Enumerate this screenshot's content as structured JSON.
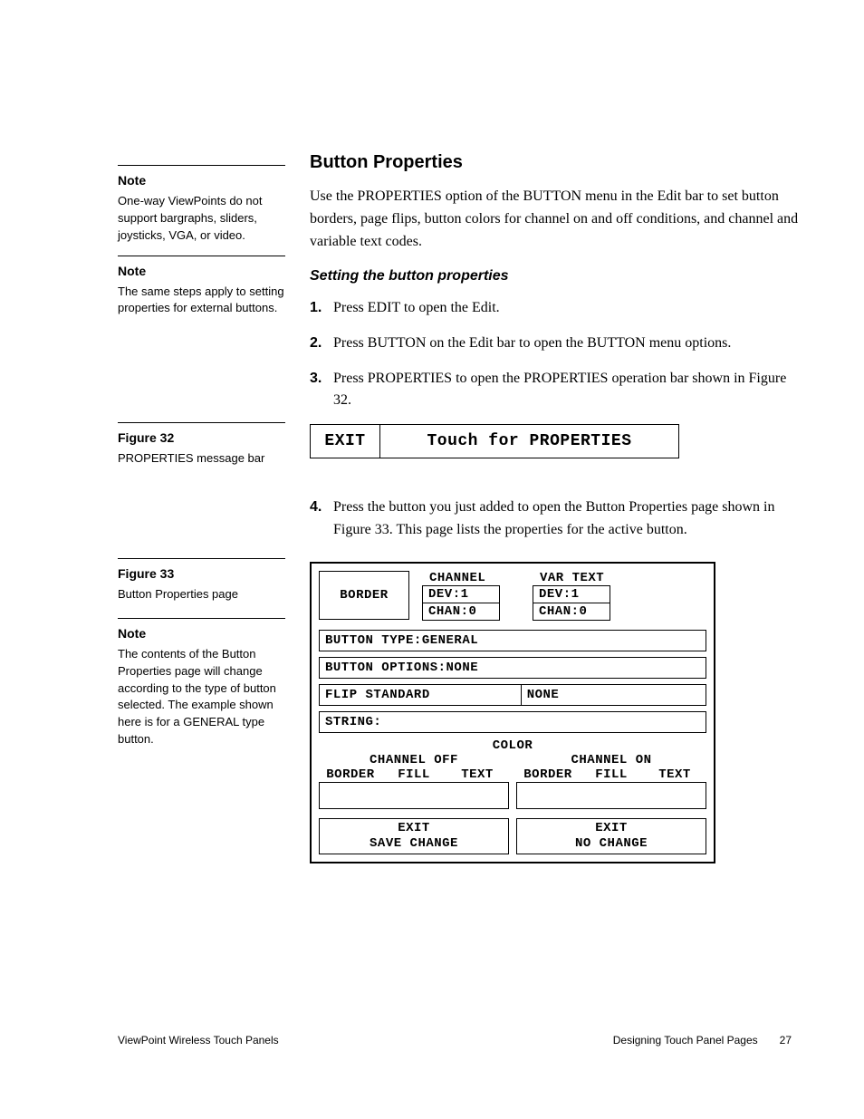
{
  "headings": {
    "button_properties": "Button Properties",
    "setting_props": "Setting the button properties"
  },
  "body": {
    "intro": "Use the PROPERTIES option of the BUTTON menu in the Edit bar to set button borders, page flips, button colors for channel on and off conditions, and channel and variable text codes."
  },
  "steps": {
    "n1": "1.",
    "s1": "Press EDIT to open the Edit.",
    "n2": "2.",
    "s2": "Press BUTTON on the Edit bar to open the BUTTON menu options.",
    "n3": "3.",
    "s3": "Press PROPERTIES to open the PROPERTIES operation bar shown in Figure 32.",
    "n4": "4.",
    "s4": "Press the button you just added to open the Button Properties page shown in Figure 33. This page lists the properties for the active button."
  },
  "sidebar": {
    "note1_head": "Note",
    "note1_text": "One-way ViewPoints do not support bargraphs, sliders, joysticks, VGA, or video.",
    "note2_head": "Note",
    "note2_text": "The same steps apply to setting properties for external buttons.",
    "fig32_head": "Figure 32",
    "fig32_text": "PROPERTIES message bar",
    "fig33_head": "Figure 33",
    "fig33_text": "Button Properties page",
    "note3_head": "Note",
    "note3_text": "The contents of the Button Properties page will change according to the type of button selected. The example shown here is for a GENERAL type button."
  },
  "fig32": {
    "exit": "EXIT",
    "touch": "Touch for PROPERTIES"
  },
  "fig33": {
    "border": "BORDER",
    "channel_lbl": "CHANNEL",
    "vartext_lbl": "VAR TEXT",
    "dev1": "DEV:1",
    "chan0": "CHAN:0",
    "btn_type": "BUTTON TYPE:GENERAL",
    "btn_opts": "BUTTON OPTIONS:NONE",
    "flip": "FLIP STANDARD",
    "none": "NONE",
    "string": "STRING:",
    "color": "COLOR",
    "ch_off": "CHANNEL OFF",
    "ch_on": "CHANNEL ON",
    "c_border": "BORDER",
    "c_fill": "FILL",
    "c_text": "TEXT",
    "exit_save1": "EXIT",
    "exit_save2": "SAVE CHANGE",
    "exit_no1": "EXIT",
    "exit_no2": "NO CHANGE"
  },
  "footer": {
    "left": "ViewPoint Wireless Touch Panels",
    "right": "Designing Touch Panel Pages",
    "page": "27"
  }
}
